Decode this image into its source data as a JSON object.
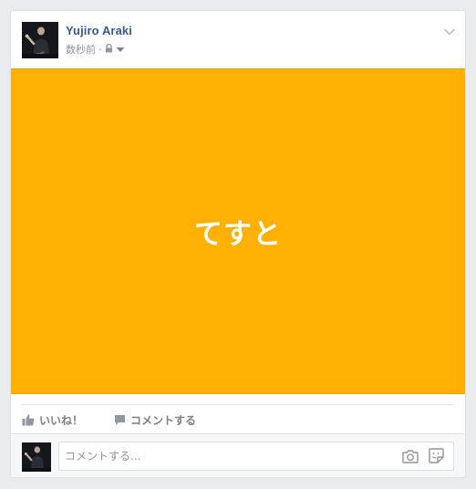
{
  "post": {
    "author_name": "Yujiro Araki",
    "timestamp": "数秒前",
    "separator": "·",
    "privacy_icon": "lock-icon",
    "options_icon": "chevron-down-icon",
    "image_bg_color": "#ffb000",
    "image_text": "てすと"
  },
  "actions": {
    "like_label": "いいね！",
    "comment_label": "コメントする"
  },
  "comment_composer": {
    "placeholder": "コメントする...",
    "camera_icon": "camera-icon",
    "sticker_icon": "sticker-icon"
  },
  "colors": {
    "author_link": "#365899",
    "meta_text": "#90949c",
    "action_text": "#7f7f7f"
  }
}
